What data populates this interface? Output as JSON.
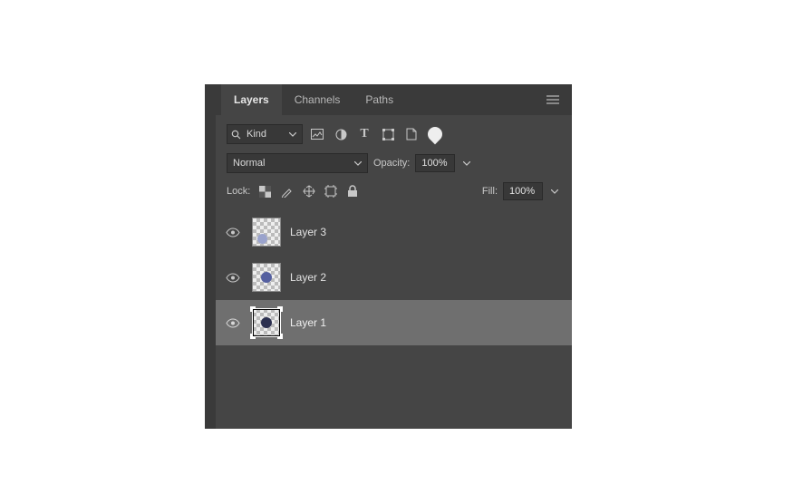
{
  "tabs": {
    "layers": "Layers",
    "channels": "Channels",
    "paths": "Paths"
  },
  "filter": {
    "kind_label": "Kind"
  },
  "blend": {
    "mode": "Normal",
    "opacity_label": "Opacity:",
    "opacity_value": "100%"
  },
  "lock": {
    "label": "Lock:",
    "fill_label": "Fill:",
    "fill_value": "100%"
  },
  "layers": [
    {
      "name": "Layer 3",
      "selected": false
    },
    {
      "name": "Layer 2",
      "selected": false
    },
    {
      "name": "Layer 1",
      "selected": true
    }
  ]
}
